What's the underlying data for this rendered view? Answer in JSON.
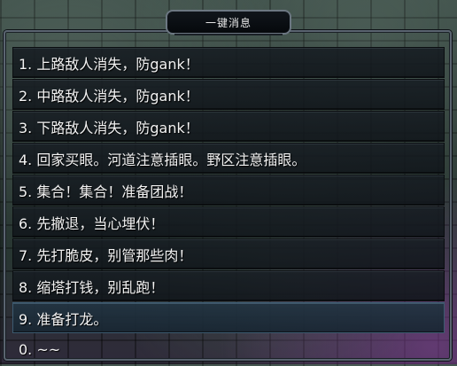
{
  "title": "一键消息",
  "items": [
    {
      "label": "1. 上路敌人消失，防gank！"
    },
    {
      "label": "2. 中路敌人消失，防gank！"
    },
    {
      "label": "3. 下路敌人消失，防gank！"
    },
    {
      "label": "4. 回家买眼。河道注意插眼。野区注意插眼。"
    },
    {
      "label": "5. 集合！集合！准备团战！"
    },
    {
      "label": "6. 先撤退，当心埋伏！"
    },
    {
      "label": "7. 先打脆皮，别管那些肉！"
    },
    {
      "label": "8. 缩塔打钱，别乱跑！"
    },
    {
      "label": "9. 准备打龙。"
    },
    {
      "label": "0. ~~"
    }
  ]
}
